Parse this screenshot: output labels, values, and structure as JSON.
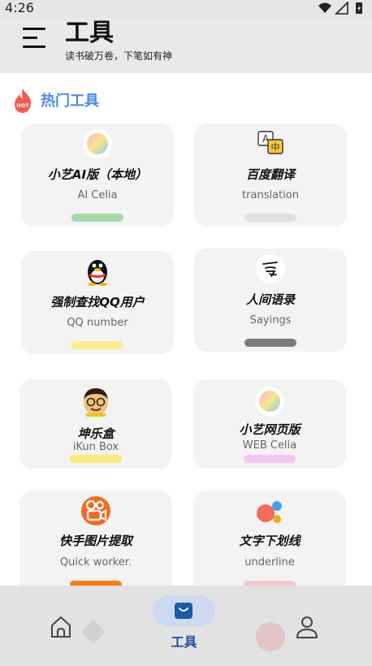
{
  "status": {
    "time": "4:26"
  },
  "header": {
    "title": "工具",
    "subtitle": "读书破万卷，下笔如有神"
  },
  "section": {
    "title": "热门工具",
    "badge": "HOT"
  },
  "cards": [
    {
      "name": "小艺AI版（本地）",
      "sub": "AI Celia",
      "bar_color": "#a8d8a8",
      "icon": "celia-icon"
    },
    {
      "name": "百度翻译",
      "sub": "translation",
      "bar_color": "#e1e1e1",
      "icon": "translate-icon"
    },
    {
      "name": "强制查找QQ用户",
      "sub": "QQ number",
      "bar_color": "#fbee8c",
      "icon": "qq-penguin-icon"
    },
    {
      "name": "人间语录",
      "sub": "Sayings",
      "bar_color": "#7a7a7a",
      "icon": "calligraphy-icon"
    },
    {
      "name": "坤乐盒",
      "sub": "iKun Box",
      "bar_color": "#fbe97a",
      "icon": "ikun-avatar-icon"
    },
    {
      "name": "小艺网页版",
      "sub": "WEB Celia",
      "bar_color": "#f6c6f2",
      "icon": "celia-icon"
    },
    {
      "name": "快手图片提取",
      "sub": "Quick worker.",
      "bar_color": "#f67e0c",
      "icon": "kuaishou-icon"
    },
    {
      "name": "文字下划线",
      "sub": "underline",
      "bar_color": "#f8c4cc",
      "icon": "underline-icon"
    }
  ],
  "nav": {
    "active_label": "工具"
  }
}
